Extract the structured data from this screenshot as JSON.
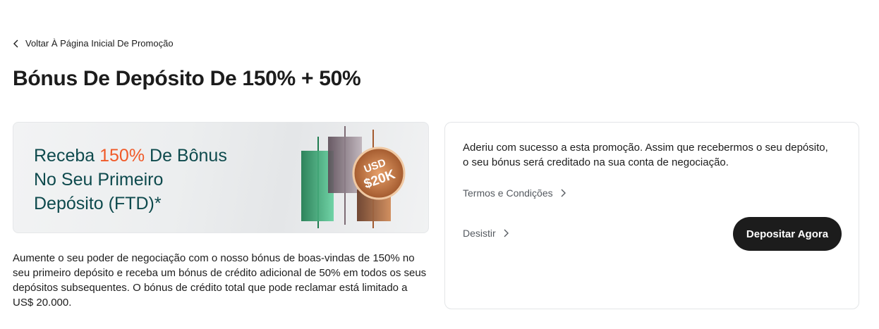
{
  "nav": {
    "back_label": "Voltar À Página Inicial De Promoção"
  },
  "page": {
    "title": "Bónus De Depósito De 150% + 50%"
  },
  "banner": {
    "line1_prefix": "Receba ",
    "line1_accent": "150%",
    "line1_suffix": " De Bônus",
    "line2": "No Seu Primeiro",
    "line3": "Depósito (FTD)*",
    "coin_line1": "USD",
    "coin_line2": "$20K",
    "accent_color": "#f05a28",
    "text_color": "#0e4a4d"
  },
  "description": "Aumente o seu poder de negociação com o nosso bónus de boas-vindas de 150% no seu primeiro depósito e receba um bónus de crédito adicional de 50% em todos os seus depósitos subsequentes. O bónus de crédito total que pode reclamar está limitado a US$ 20.000.",
  "card": {
    "message": "Aderiu com sucesso a esta promoção. Assim que recebermos o seu depósito, o seu bónus será creditado na sua conta de negociação.",
    "terms_label": "Termos e Condições",
    "cancel_label": "Desistir",
    "deposit_label": "Depositar Agora"
  },
  "icons": {
    "back": "chevron-left-icon",
    "link": "chevron-right-icon"
  }
}
